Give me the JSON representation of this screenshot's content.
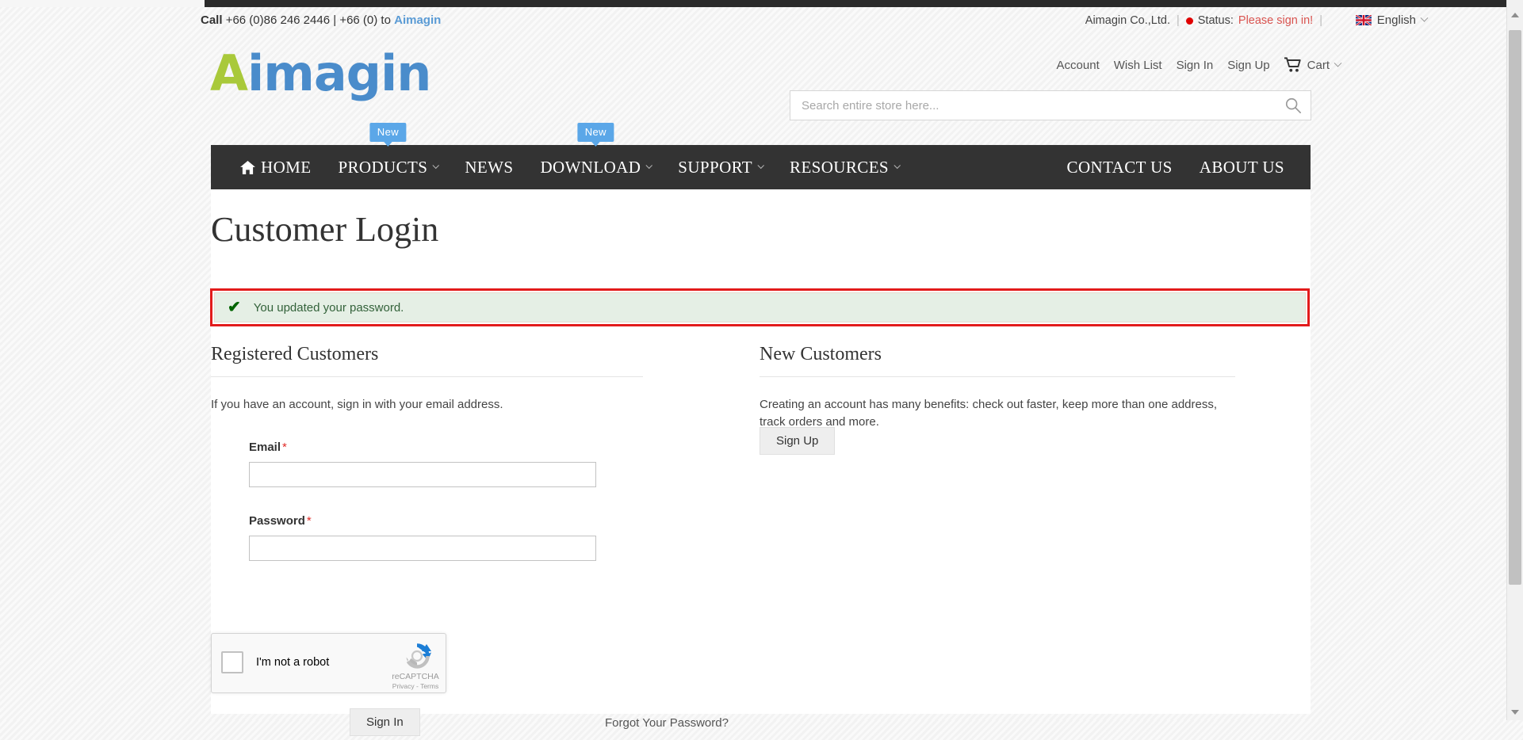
{
  "colors": {
    "nav_bg": "#333333",
    "badge_blue": "#5ba7e8",
    "logo_green": "#a9c93a",
    "logo_blue": "#4a8ccb",
    "status_red": "#d9534f",
    "annotation_red": "#e21b1b",
    "success_bg": "#e5efe5",
    "success_text": "#33623a"
  },
  "utility": {
    "call_label": "Call",
    "phone_primary": "+66 (0)86 246 2446",
    "phone_sep": "|",
    "phone_secondary": "+66 (0) to",
    "brand_word": "Aimagin",
    "company": "Aimagin Co.,Ltd.",
    "status_label": "Status:",
    "status_value": "Please sign in!",
    "status_dot_icon": "red-dot-icon",
    "language": "English",
    "language_flag_icon": "uk-flag-icon",
    "language_chevron_icon": "chevron-down-icon"
  },
  "logo": {
    "first_letter": "A",
    "rest": "imagin"
  },
  "account_links": [
    {
      "label": "Account",
      "name": "account"
    },
    {
      "label": "Wish List",
      "name": "wish-list"
    },
    {
      "label": "Sign In",
      "name": "sign-in"
    },
    {
      "label": "Sign Up",
      "name": "sign-up"
    }
  ],
  "cart": {
    "label": "Cart",
    "icon": "shopping-cart-icon",
    "chevron_icon": "chevron-down-icon"
  },
  "search": {
    "value": "",
    "placeholder": "Search entire store here...",
    "icon": "search-icon"
  },
  "nav": {
    "left_items": [
      {
        "label": "HOME",
        "icon": "home-icon",
        "badge": "",
        "chevron": false
      },
      {
        "label": "PRODUCTS",
        "icon": "",
        "badge": "New",
        "chevron": true
      },
      {
        "label": "NEWS",
        "icon": "",
        "badge": "",
        "chevron": false
      },
      {
        "label": "DOWNLOAD",
        "icon": "",
        "badge": "New",
        "chevron": true
      },
      {
        "label": "SUPPORT",
        "icon": "",
        "badge": "",
        "chevron": true
      },
      {
        "label": "RESOURCES",
        "icon": "",
        "badge": "",
        "chevron": true
      }
    ],
    "right_items": [
      {
        "label": "CONTACT US"
      },
      {
        "label": "ABOUT US"
      }
    ]
  },
  "main": {
    "page_title": "Customer Login",
    "message": {
      "icon": "check-icon",
      "text": "You updated your password."
    },
    "registered": {
      "title": "Registered Customers",
      "note": "If you have an account, sign in with your email address.",
      "email_label": "Email",
      "email_required": "*",
      "email_value": "",
      "password_label": "Password",
      "password_required": "*",
      "password_value": "",
      "signin_button": "Sign In",
      "forgot_link": "Forgot Your Password?"
    },
    "new_customers": {
      "title": "New Customers",
      "note": "Creating an account has many benefits: check out faster, keep more than one address, track orders and more.",
      "signup_button": "Sign Up"
    },
    "recaptcha": {
      "checkbox_label": "I'm not a robot",
      "brand": "reCAPTCHA",
      "legal": "Privacy - Terms",
      "logo_icon": "recaptcha-logo-icon"
    }
  },
  "scrollbar": {
    "up_icon": "scroll-up-arrow-icon",
    "down_icon": "scroll-down-arrow-icon"
  }
}
